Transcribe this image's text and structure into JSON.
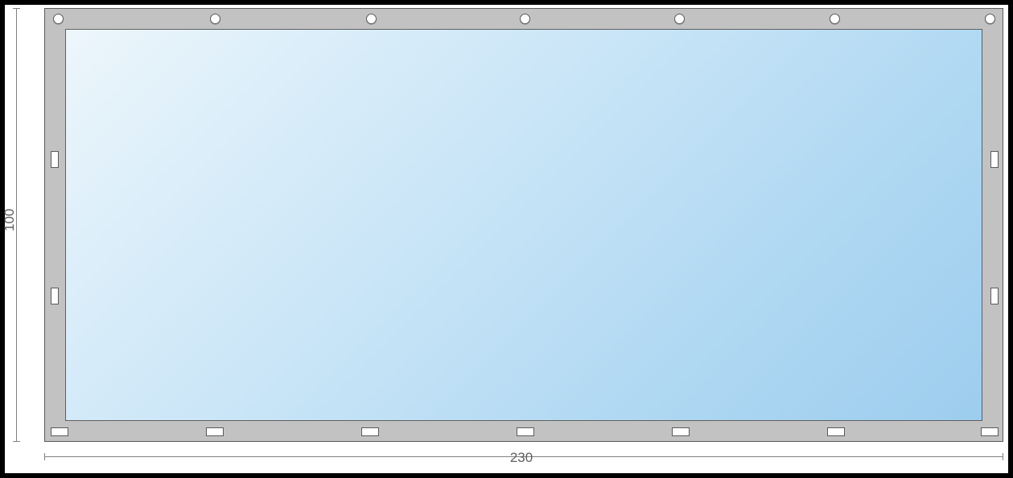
{
  "dimensions": {
    "width_label": "230",
    "height_label": "100"
  },
  "tarp": {
    "frame_color": "#c2c2c2",
    "cover_gradient": [
      "#edf6fb",
      "#9dcdee"
    ],
    "eyelets_top_count": 7,
    "loops_bottom_count": 7,
    "loops_side_count_each": 2
  }
}
